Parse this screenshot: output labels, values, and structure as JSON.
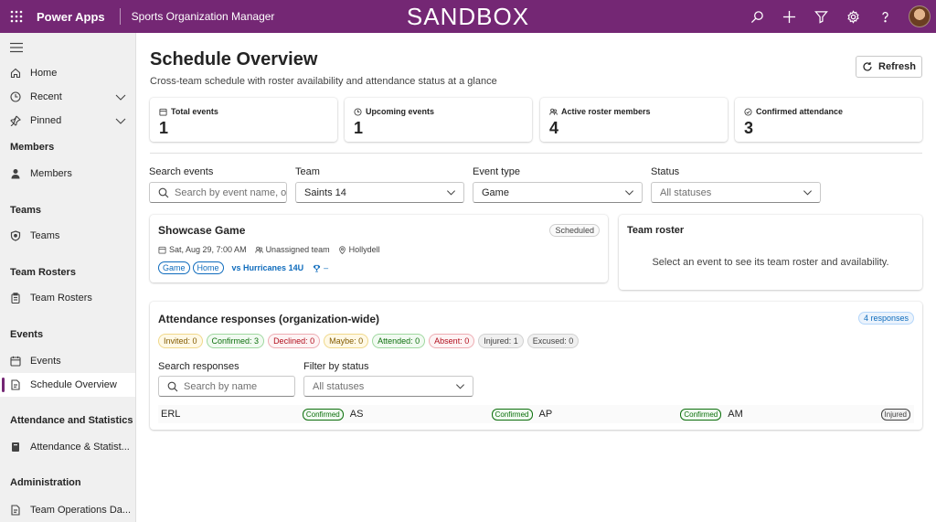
{
  "topbar": {
    "brand": "Power Apps",
    "app_name": "Sports Organization Manager",
    "environment": "SANDBOX",
    "icons": [
      "search-icon",
      "plus-icon",
      "filter-icon",
      "gear-icon",
      "help-icon"
    ],
    "accent_color": "#742774"
  },
  "sidebar": {
    "top_items": [
      {
        "label": "Home",
        "icon": "home-icon"
      },
      {
        "label": "Recent",
        "icon": "clock-icon"
      },
      {
        "label": "Pinned",
        "icon": "pin-icon"
      }
    ],
    "sections": [
      {
        "title": "Members",
        "items": [
          {
            "label": "Members",
            "icon": "person-icon"
          }
        ]
      },
      {
        "title": "Teams",
        "items": [
          {
            "label": "Teams",
            "icon": "shield-icon"
          }
        ]
      },
      {
        "title": "Team Rosters",
        "items": [
          {
            "label": "Team Rosters",
            "icon": "clipboard-icon"
          }
        ]
      },
      {
        "title": "Events",
        "items": [
          {
            "label": "Events",
            "icon": "calendar-icon"
          },
          {
            "label": "Schedule Overview",
            "icon": "document-icon",
            "active": true
          }
        ]
      },
      {
        "title": "Attendance and Statistics",
        "items": [
          {
            "label": "Attendance & Statist...",
            "icon": "notebook-icon"
          }
        ]
      },
      {
        "title": "Administration",
        "items": [
          {
            "label": "Team Operations Da...",
            "icon": "document-icon"
          }
        ]
      }
    ]
  },
  "page": {
    "title": "Schedule Overview",
    "subtitle": "Cross-team schedule with roster availability and attendance status at a glance",
    "refresh_label": "Refresh"
  },
  "stats": [
    {
      "label": "Total events",
      "value": "1",
      "icon": "calendar-icon"
    },
    {
      "label": "Upcoming events",
      "value": "1",
      "icon": "clock-icon"
    },
    {
      "label": "Active roster members",
      "value": "4",
      "icon": "people-icon"
    },
    {
      "label": "Confirmed attendance",
      "value": "3",
      "icon": "check-circle-icon"
    }
  ],
  "filters": {
    "search_label": "Search events",
    "search_placeholder": "Search by event name, op",
    "team_label": "Team",
    "team_value": "Saints 14",
    "type_label": "Event type",
    "type_value": "Game",
    "status_label": "Status",
    "status_value": "All statuses"
  },
  "event": {
    "title": "Showcase Game",
    "status": "Scheduled",
    "datetime": "Sat, Aug 29, 7:00 AM",
    "team": "Unassigned team",
    "location": "Hollydell",
    "tags": [
      "Game",
      "Home"
    ],
    "opponent": "vs Hurricanes 14U",
    "result": "–"
  },
  "roster": {
    "title": "Team roster",
    "empty_message": "Select an event to see its team roster and availability."
  },
  "attendance": {
    "title": "Attendance responses (organization-wide)",
    "count_badge": "4 responses",
    "pills": [
      {
        "label": "Invited: 0",
        "kind": "invited"
      },
      {
        "label": "Confirmed: 3",
        "kind": "confirmed"
      },
      {
        "label": "Declined: 0",
        "kind": "declined"
      },
      {
        "label": "Maybe: 0",
        "kind": "maybe"
      },
      {
        "label": "Attended: 0",
        "kind": "attended"
      },
      {
        "label": "Absent: 0",
        "kind": "absent"
      },
      {
        "label": "Injured: 1",
        "kind": "injured"
      },
      {
        "label": "Excused: 0",
        "kind": "excused"
      }
    ],
    "search_label": "Search responses",
    "search_placeholder": "Search by name",
    "filter_label": "Filter by status",
    "filter_value": "All statuses",
    "responses": [
      {
        "name": "ERL",
        "status": "Confirmed"
      },
      {
        "name": "AS",
        "status": "Confirmed"
      },
      {
        "name": "AP",
        "status": "Confirmed"
      },
      {
        "name": "AM",
        "status": "Injured"
      }
    ]
  }
}
